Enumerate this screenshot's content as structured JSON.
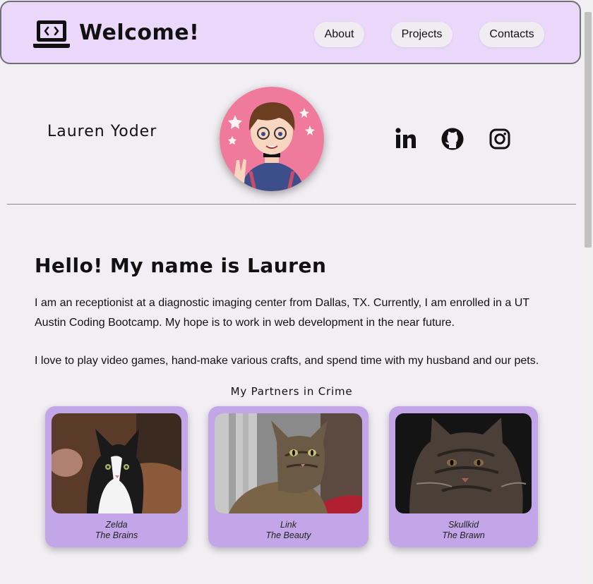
{
  "header": {
    "title": "Welcome!",
    "nav": [
      "About",
      "Projects",
      "Contacts"
    ]
  },
  "profile": {
    "name": "Lauren Yoder",
    "social": [
      "linkedin-icon",
      "github-icon",
      "instagram-icon"
    ]
  },
  "main": {
    "heading": "Hello! My name is Lauren",
    "paragraph1": "I am an receptionist at a diagnostic imaging center from Dallas, TX. Currently, I am enrolled in a UT Austin Coding Bootcamp. My hope is to work in web development in the near future.",
    "paragraph2": "I love to play video games, hand-make various crafts, and spend time with my husband and our pets.",
    "partners_title": "My Partners in Crime",
    "pets": [
      {
        "name": "Zelda",
        "title": "The Brains"
      },
      {
        "name": "Link",
        "title": "The Beauty"
      },
      {
        "name": "Skullkid",
        "title": "The Brawn"
      }
    ]
  },
  "colors": {
    "header_bg": "#ead8fb",
    "card_bg": "#c3a6e8",
    "page_bg": "#f1eff3"
  }
}
